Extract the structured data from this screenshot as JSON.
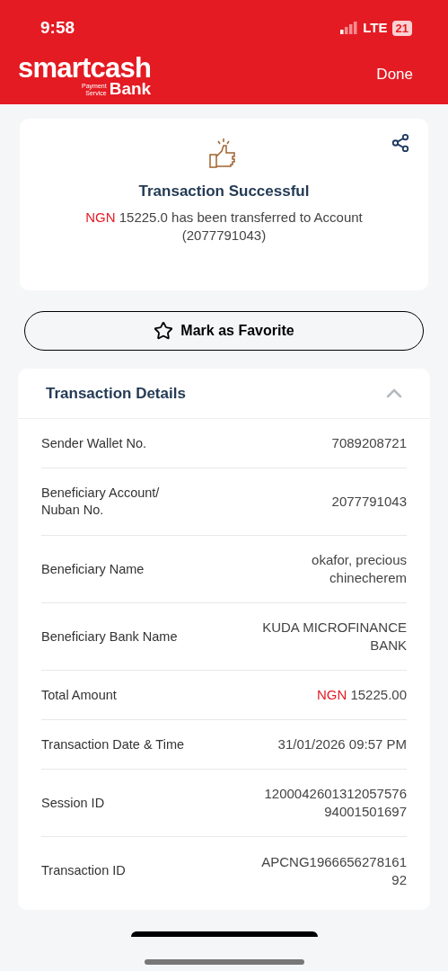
{
  "status_bar": {
    "time": "9:58",
    "network": "LTE",
    "battery": "21"
  },
  "header": {
    "logo_main": "smartcash",
    "logo_small": [
      "Payment",
      "Service"
    ],
    "logo_bank": "Bank",
    "done": "Done"
  },
  "result": {
    "title": "Transaction Successful",
    "currency": "NGN",
    "message": [
      "15225.0 has been transferred to Account",
      "(2077791043)"
    ]
  },
  "favorite_button": {
    "label": "Mark as Favorite"
  },
  "details": {
    "title": "Transaction Details",
    "expanded": true,
    "rows": [
      {
        "label": [
          "Sender Wallet No."
        ],
        "value": [
          "7089208721"
        ]
      },
      {
        "label": [
          "Beneficiary Account/",
          "Nuban No."
        ],
        "value": [
          "2077791043"
        ]
      },
      {
        "label": [
          "Beneficiary Name"
        ],
        "value": [
          "okafor, precious",
          "chinecherem"
        ]
      },
      {
        "label": [
          "Beneficiary Bank Name"
        ],
        "value": [
          "KUDA MICROFINANCE",
          "BANK"
        ]
      },
      {
        "label": [
          "Total Amount"
        ],
        "currency": "NGN",
        "value": [
          "15225.00"
        ]
      },
      {
        "label": [
          "Transaction Date & Time"
        ],
        "value": [
          "31/01/2026 09:57 PM"
        ]
      },
      {
        "label": [
          "Session ID"
        ],
        "value": [
          "1200042601312057576",
          "94001501697"
        ]
      },
      {
        "label": [
          "Transaction ID"
        ],
        "value": [
          "APCNG1966656278161",
          "92"
        ]
      }
    ]
  }
}
